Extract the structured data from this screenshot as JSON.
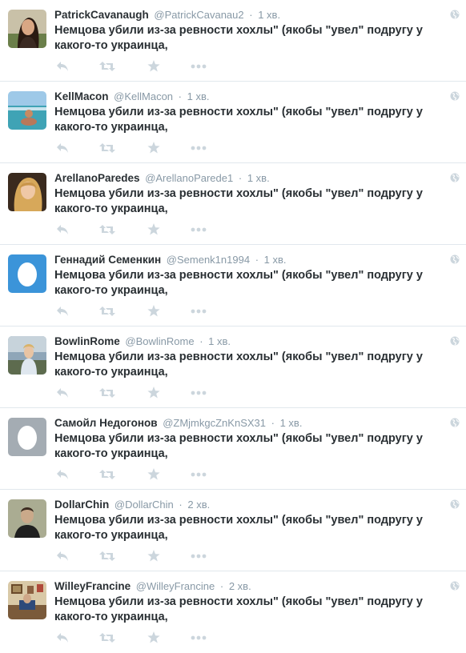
{
  "tweets": [
    {
      "fullname": "PatrickCavanaugh",
      "username": "@PatrickCavanau2",
      "separator": "·",
      "time": "1 хв.",
      "text": "Немцова убили из-за ревности хохлы\" (якобы \"увел\" подругу у какого-то украинца,",
      "avatar": "photo-woman-dark-hair"
    },
    {
      "fullname": "KellMacon",
      "username": "@KellMacon",
      "separator": "·",
      "time": "1 хв.",
      "text": "Немцова убили из-за ревности хохлы\" (якобы \"увел\" подругу у какого-то украинца,",
      "avatar": "photo-person-beach"
    },
    {
      "fullname": "ArellanoParedes",
      "username": "@ArellanoParede1",
      "separator": "·",
      "time": "1 хв.",
      "text": "Немцова убили из-за ревности хохлы\" (якобы \"увел\" подругу у какого-то украинца,",
      "avatar": "photo-woman-blonde"
    },
    {
      "fullname": "Геннадий Семенкин",
      "username": "@Semenk1n1994",
      "separator": "·",
      "time": "1 хв.",
      "text": "Немцова убили из-за ревности хохлы\" (якобы \"увел\" подругу у какого-то украинца,",
      "avatar": "default-egg-blue"
    },
    {
      "fullname": "BowlinRome",
      "username": "@BowlinRome",
      "separator": "·",
      "time": "1 хв.",
      "text": "Немцова убили из-за ревности хохлы\" (якобы \"увел\" подругу у какого-то украинца,",
      "avatar": "photo-woman-outdoor"
    },
    {
      "fullname": "Самойл Недогонов",
      "username": "@ZMjmkgcZnKnSX31",
      "separator": "·",
      "time": "1 хв.",
      "text": "Немцова убили из-за ревности хохлы\" (якобы \"увел\" подругу у какого-то украинца,",
      "avatar": "default-egg-gray"
    },
    {
      "fullname": "DollarChin",
      "username": "@DollarChin",
      "separator": "·",
      "time": "2 хв.",
      "text": "Немцова убили из-за ревности хохлы\" (якобы \"увел\" подругу у какого-то украинца,",
      "avatar": "photo-man-portrait"
    },
    {
      "fullname": "WilleyFrancine",
      "username": "@WilleyFrancine",
      "separator": "·",
      "time": "2 хв.",
      "text": "Немцова убили из-за ревности хохлы\" (якобы \"увел\" подругу у какого-то украинца,",
      "avatar": "photo-room-interior"
    }
  ],
  "actions": [
    "reply-icon",
    "retweet-icon",
    "favorite-icon",
    "more-icon"
  ],
  "colors": {
    "text": "#292f33",
    "muted": "#8899a6",
    "icon": "#ccd6dd",
    "divider": "#e1e8ed",
    "egg_blue": "#3b94d9",
    "egg_gray": "#a4acb3"
  }
}
